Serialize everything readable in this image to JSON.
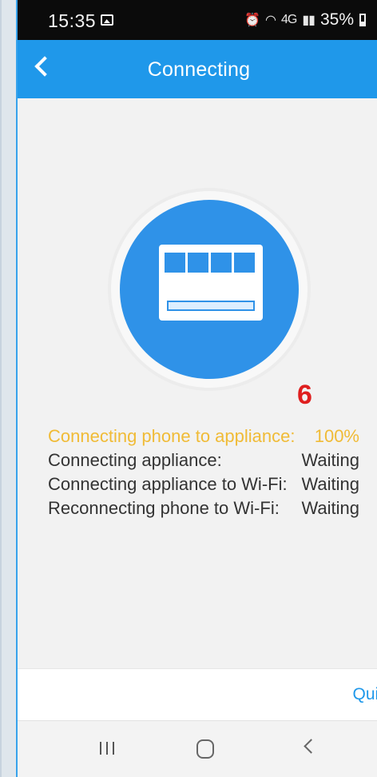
{
  "status_bar": {
    "time": "15:35",
    "image_icon": "image-notification-icon",
    "alarm_icon": "alarm-icon",
    "wifi_icon": "wifi-icon",
    "signal_label": "4G",
    "battery_percent": "35%",
    "battery_icon": "battery-icon"
  },
  "header": {
    "title": "Connecting",
    "back_icon": "chevron-left-icon"
  },
  "device": {
    "icon": "appliance-icon"
  },
  "annotation": {
    "step_number": "6"
  },
  "status_list": [
    {
      "label": "Connecting phone to appliance:",
      "value": "100%",
      "active": true
    },
    {
      "label": "Connecting appliance:",
      "value": "Waiting",
      "active": false
    },
    {
      "label": "Connecting appliance to Wi-Fi:",
      "value": "Waiting",
      "active": false
    },
    {
      "label": "Reconnecting phone to Wi-Fi:",
      "value": "Waiting",
      "active": false
    }
  ],
  "actions": {
    "quit_label": "Quit"
  },
  "navigation": {
    "recent_icon": "recent-apps-icon",
    "home_icon": "home-icon",
    "back_icon": "back-icon"
  },
  "colors": {
    "primary": "#1f98ea",
    "active_text": "#f0bb36",
    "annotation": "#df1f1f"
  }
}
